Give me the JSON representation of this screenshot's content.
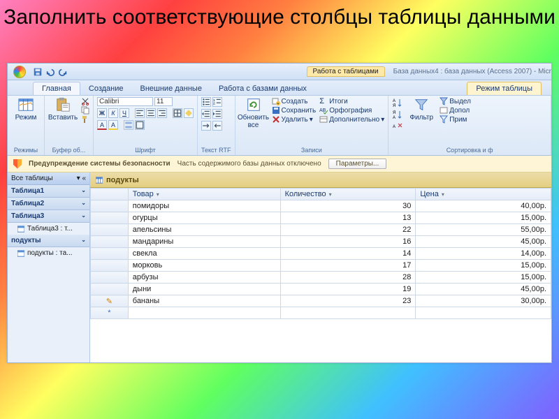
{
  "slide": {
    "title": "Заполнить соответствующие столбцы таблицы данными"
  },
  "window": {
    "context_tab": "Работа с таблицами",
    "title": "База данных4 : база данных (Access 2007) - Micr"
  },
  "tabs": {
    "home": "Главная",
    "create": "Создание",
    "external": "Внешние данные",
    "dbtools": "Работа с базами данных",
    "table_tool": "Режим таблицы"
  },
  "ribbon": {
    "views": {
      "btn": "Режим",
      "label": "Режимы"
    },
    "clipboard": {
      "btn": "Вставить",
      "label": "Буфер об..."
    },
    "font": {
      "name": "Calibri",
      "size": "11",
      "label": "Шрифт",
      "bold": "Ж",
      "italic": "К",
      "underline": "Ч"
    },
    "richtext": {
      "label": "Текст RTF"
    },
    "records": {
      "refresh": "Обновить все",
      "new": "Создать",
      "save": "Сохранить",
      "delete": "Удалить",
      "totals": "Итоги",
      "spell": "Орфография",
      "more": "Дополнительно",
      "label": "Записи"
    },
    "sortfilter": {
      "filter": "Фильтр",
      "select": "Выдел",
      "adv": "Допол",
      "toggle": "Прим",
      "label": "Сортировка и ф"
    }
  },
  "security": {
    "heading": "Предупреждение системы безопасности",
    "msg": "Часть содержимого базы данных отключено",
    "btn": "Параметры..."
  },
  "nav": {
    "header": "Все таблицы",
    "groups": [
      {
        "name": "Таблица1"
      },
      {
        "name": "Таблица2"
      },
      {
        "name": "Таблица3",
        "items": [
          "Таблица3 : т..."
        ]
      },
      {
        "name": "подукты",
        "items": [
          "подукты : та..."
        ]
      }
    ]
  },
  "datasheet": {
    "tab": "подукты",
    "columns": [
      "Товар",
      "Количество",
      "Цена"
    ],
    "rows": [
      {
        "name": "помидоры",
        "qty": "30",
        "price": "40,00р."
      },
      {
        "name": "огурцы",
        "qty": "13",
        "price": "15,00р."
      },
      {
        "name": "апельсины",
        "qty": "22",
        "price": "55,00р."
      },
      {
        "name": "мандарины",
        "qty": "16",
        "price": "45,00р."
      },
      {
        "name": "свекла",
        "qty": "14",
        "price": "14,00р."
      },
      {
        "name": "морковь",
        "qty": "17",
        "price": "15,00р."
      },
      {
        "name": "арбузы",
        "qty": "28",
        "price": "15,00р."
      },
      {
        "name": "дыни",
        "qty": "19",
        "price": "45,00р."
      },
      {
        "name": "бананы",
        "qty": "23",
        "price": "30,00р.",
        "editing": true
      }
    ],
    "sigma": "Σ"
  }
}
